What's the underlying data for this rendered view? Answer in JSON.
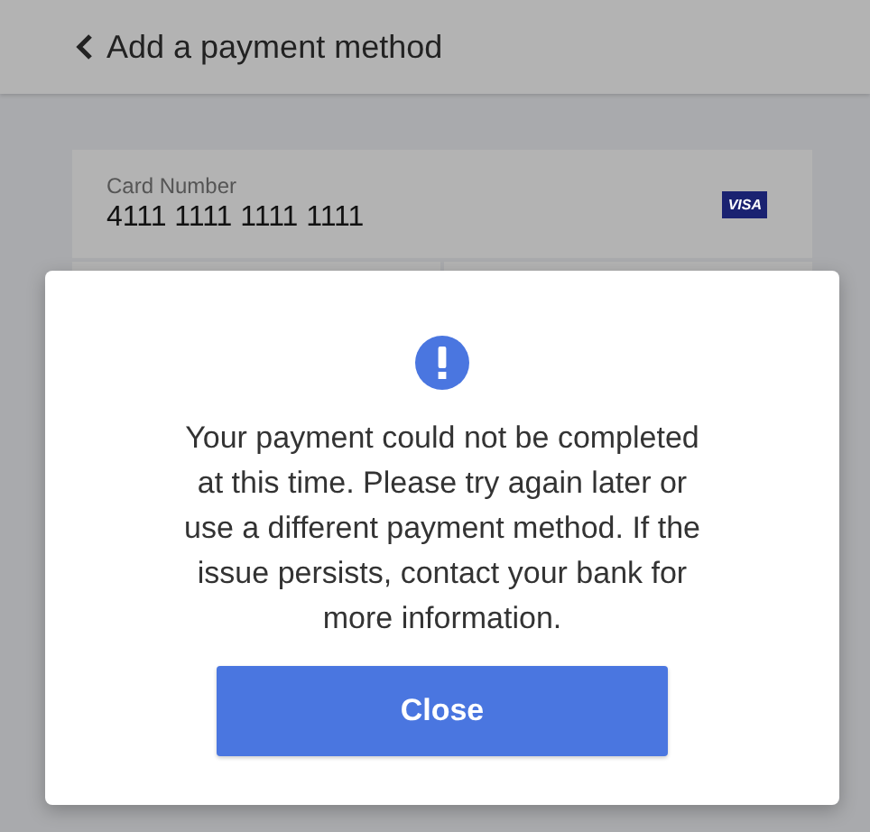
{
  "header": {
    "title": "Add a payment method"
  },
  "card_field": {
    "label": "Card Number",
    "value": "4111 1111 1111 1111",
    "brand": "VISA"
  },
  "dialog": {
    "message": "Your payment could not be completed at this time. Please try again later or use a different payment method. If the issue persists, contact your bank for more information.",
    "button": "Close"
  }
}
